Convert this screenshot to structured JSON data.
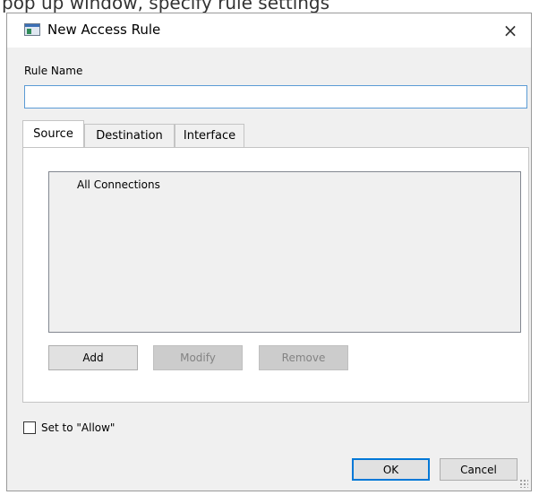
{
  "caption": "pop up window, specify rule settings",
  "window": {
    "title": "New Access Rule",
    "close_glyph": "×",
    "app_icon": "window-icon"
  },
  "form": {
    "rule_name_label": "Rule Name",
    "rule_name_value": "",
    "rule_name_placeholder": ""
  },
  "tabs": [
    {
      "label": "Source",
      "active": true
    },
    {
      "label": "Destination",
      "active": false
    },
    {
      "label": "Interface",
      "active": false
    }
  ],
  "source_list": {
    "items": [
      "All Connections"
    ]
  },
  "list_buttons": {
    "add": "Add",
    "modify": "Modify",
    "remove": "Remove"
  },
  "allow_checkbox": {
    "label": "Set to \"Allow\"",
    "checked": false
  },
  "dialog_buttons": {
    "ok": "OK",
    "cancel": "Cancel"
  },
  "colors": {
    "accent": "#0078d7",
    "input_focus_border": "#5b9bd5",
    "dialog_background": "#f0f0f0"
  }
}
